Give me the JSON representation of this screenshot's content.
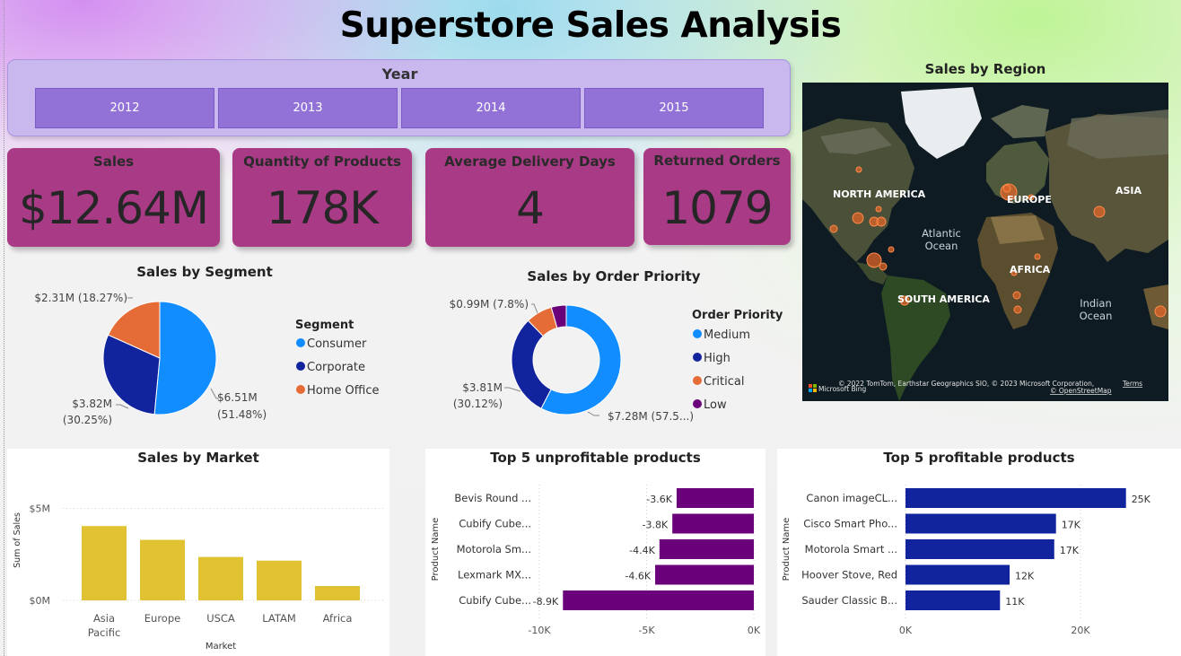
{
  "title": "Superstore Sales Analysis",
  "slicer": {
    "title": "Year",
    "options": [
      "2012",
      "2013",
      "2014",
      "2015"
    ]
  },
  "kpis": [
    {
      "label": "Sales",
      "value": "$12.64M"
    },
    {
      "label": "Quantity of Products",
      "value": "178K"
    },
    {
      "label": "Average Delivery Days",
      "value": "4"
    },
    {
      "label": "Returned Orders",
      "value": "1079"
    }
  ],
  "map": {
    "title": "Sales by Region",
    "labels": {
      "north_america": "NORTH AMERICA",
      "europe": "EUROPE",
      "asia": "ASIA",
      "atlantic_line1": "Atlantic",
      "atlantic_line2": "Ocean",
      "africa": "AFRICA",
      "south_america": "SOUTH AMERICA",
      "indian_line1": "Indian",
      "indian_line2": "Ocean"
    },
    "attribution": "© 2022 TomTom, Earthstar Geographics SIO, © 2023 Microsoft Corporation,",
    "terms": "Terms",
    "osm": "© OpenStreetMap",
    "brand": "Microsoft Bing"
  },
  "colors": {
    "kpi_bg": "#a93a86",
    "slicer_btn": "#9372d7",
    "segment_consumer": "#118dff",
    "segment_corporate": "#12239e",
    "segment_home": "#e66c37",
    "priority_low": "#6b007b",
    "market_bar": "#e0c232",
    "unprofitable_bar": "#6b007b",
    "profitable_bar": "#12239e"
  },
  "chart_data": [
    {
      "type": "pie",
      "title": "Sales by Segment",
      "legend_title": "Segment",
      "legend_position": "right",
      "slices": [
        {
          "name": "Consumer",
          "value": 6.51,
          "label_line1": "$6.51M",
          "label_line2": "(51.48%)"
        },
        {
          "name": "Corporate",
          "value": 3.82,
          "label_line1": "$3.82M",
          "label_line2": "(30.25%)"
        },
        {
          "name": "Home Office",
          "value": 2.31,
          "label_line1": "$2.31M (18.27%)",
          "label_line2": ""
        }
      ]
    },
    {
      "type": "pie",
      "subtype": "donut",
      "title": "Sales by Order Priority",
      "legend_title": "Order Priority",
      "legend_position": "right",
      "slices": [
        {
          "name": "Medium",
          "value": 7.28,
          "label_line1": "$7.28M (57.5...)",
          "label_line2": ""
        },
        {
          "name": "High",
          "value": 3.81,
          "label_line1": "$3.81M",
          "label_line2": "(30.12%)"
        },
        {
          "name": "Critical",
          "value": 0.99,
          "label_line1": "$0.99M (7.8%)",
          "label_line2": ""
        },
        {
          "name": "Low",
          "value": 0.56,
          "label_line1": "",
          "label_line2": ""
        }
      ]
    },
    {
      "type": "bar",
      "title": "Sales by Market",
      "xlabel": "Market",
      "ylabel": "Sum of Sales",
      "ylim": [
        0,
        6.1
      ],
      "yticks": [
        {
          "value": 0,
          "label": "$0M"
        },
        {
          "value": 5,
          "label": "$5M"
        }
      ],
      "grid": true,
      "categories": [
        [
          "Asia",
          "Pacific"
        ],
        [
          "Europe"
        ],
        [
          "USCA"
        ],
        [
          "LATAM"
        ],
        [
          "Africa"
        ]
      ],
      "values": [
        4.04,
        3.29,
        2.36,
        2.16,
        0.78
      ]
    },
    {
      "type": "bar",
      "orientation": "horizontal",
      "title": "Top 5 unprofitable products",
      "ylabel": "Product Name",
      "xlim": [
        -10000,
        0
      ],
      "xticks": [
        {
          "value": -10000,
          "label": "-10K"
        },
        {
          "value": -5000,
          "label": "-5K"
        },
        {
          "value": 0,
          "label": "0K"
        }
      ],
      "grid": true,
      "categories": [
        "Bevis Round ...",
        "Cubify Cube...",
        "Motorola Sm...",
        "Lexmark MX...",
        "Cubify Cube..."
      ],
      "values": [
        -3600,
        -3800,
        -4400,
        -4600,
        -8900
      ],
      "data_labels": [
        "-3.6K",
        "-3.8K",
        "-4.4K",
        "-4.6K",
        "-8.9K"
      ]
    },
    {
      "type": "bar",
      "orientation": "horizontal",
      "title": "Top 5 profitable products",
      "ylabel": "Product Name",
      "xlim": [
        0,
        28000
      ],
      "xticks": [
        {
          "value": 0,
          "label": "0K"
        },
        {
          "value": 20000,
          "label": "20K"
        }
      ],
      "grid": true,
      "categories": [
        "Canon imageCL...",
        "Cisco Smart Pho...",
        "Motorola Smart ...",
        "Hoover Stove, Red",
        "Sauder Classic B..."
      ],
      "values": [
        25200,
        17200,
        17000,
        11900,
        10800
      ],
      "data_labels": [
        "25K",
        "17K",
        "17K",
        "12K",
        "11K"
      ]
    }
  ]
}
